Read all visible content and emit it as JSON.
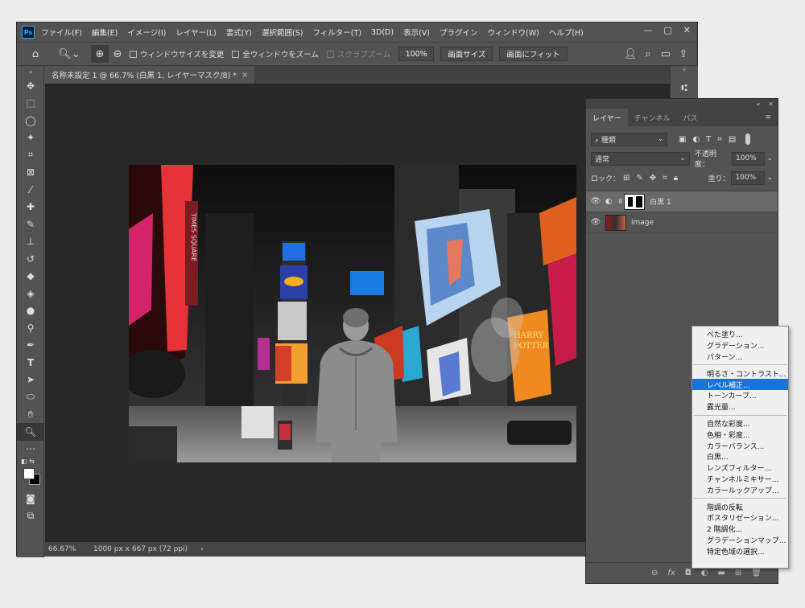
{
  "app": {
    "logo": "Ps"
  },
  "menubar": {
    "items": [
      "ファイル(F)",
      "編集(E)",
      "イメージ(I)",
      "レイヤー(L)",
      "書式(Y)",
      "選択範囲(S)",
      "フィルター(T)",
      "3D(D)",
      "表示(V)",
      "プラグイン",
      "ウィンドウ(W)",
      "ヘルプ(H)"
    ]
  },
  "options": {
    "resize_windows": "ウィンドウサイズを変更",
    "zoom_all": "全ウィンドウをズーム",
    "scrubby_zoom": "スクラブズーム",
    "zoom_value": "100%",
    "fit_screen": "画面サイズ",
    "fill_screen": "画面にフィット"
  },
  "document": {
    "tab_title": "名称未設定 1 @ 66.7% (白黒 1, レイヤーマスク/8) *",
    "status_zoom": "66.67%",
    "status_info": "1000 px x 667 px (72 ppi)"
  },
  "layers_panel": {
    "tabs": [
      "レイヤー",
      "チャンネル",
      "パス"
    ],
    "filter_kind": "種類",
    "blend_mode": "通常",
    "opacity_label": "不透明度：",
    "opacity_value": "100%",
    "lock_label": "ロック：",
    "fill_label": "塗り：",
    "fill_value": "100%",
    "layers": [
      {
        "name": "白黒 1",
        "selected": true
      },
      {
        "name": "image",
        "selected": false
      }
    ]
  },
  "adjust_menu": {
    "group1": [
      "べた塗り...",
      "グラデーション...",
      "パターン..."
    ],
    "group2": [
      "明るさ・コントラスト...",
      "レベル補正...",
      "トーンカーブ...",
      "露光量..."
    ],
    "group3": [
      "自然な彩度...",
      "色相・彩度...",
      "カラーバランス...",
      "白黒...",
      "レンズフィルター...",
      "チャンネルミキサー...",
      "カラールックアップ..."
    ],
    "group4": [
      "階調の反転",
      "ポスタリゼーション...",
      "2 階調化...",
      "グラデーションマップ...",
      "特定色域の選択..."
    ],
    "highlighted": "レベル補正..."
  },
  "colors": {
    "accent": "#1a73d9",
    "panel": "#535353",
    "canvas": "#282828"
  }
}
